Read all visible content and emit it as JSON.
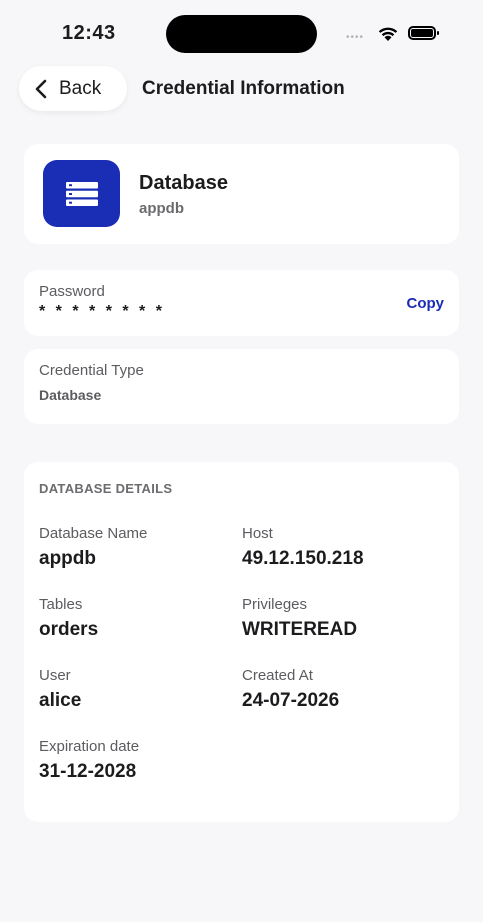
{
  "status_bar": {
    "time": "12:43",
    "signal": "••••"
  },
  "header": {
    "back_label": "Back",
    "title": "Credential Information"
  },
  "summary": {
    "title": "Database",
    "subtitle": "appdb",
    "icon": "database-icon",
    "icon_bg": "#1a2db5"
  },
  "password": {
    "label": "Password",
    "value": "* * * * * * * *",
    "copy_label": "Copy"
  },
  "credential_type": {
    "label": "Credential Type",
    "value": "Database"
  },
  "details": {
    "heading": "DATABASE DETAILS",
    "fields": [
      {
        "label": "Database Name",
        "value": "appdb"
      },
      {
        "label": "Host",
        "value": "49.12.150.218"
      },
      {
        "label": "Tables",
        "value": "orders"
      },
      {
        "label": "Privileges",
        "value": "WRITEREAD"
      },
      {
        "label": "User",
        "value": "alice"
      },
      {
        "label": "Created At",
        "value": "24-07-2026"
      },
      {
        "label": "Expiration date",
        "value": "31-12-2028"
      }
    ]
  },
  "colors": {
    "accent": "#1a2db5",
    "background": "#f7f7f9",
    "card": "#ffffff"
  }
}
